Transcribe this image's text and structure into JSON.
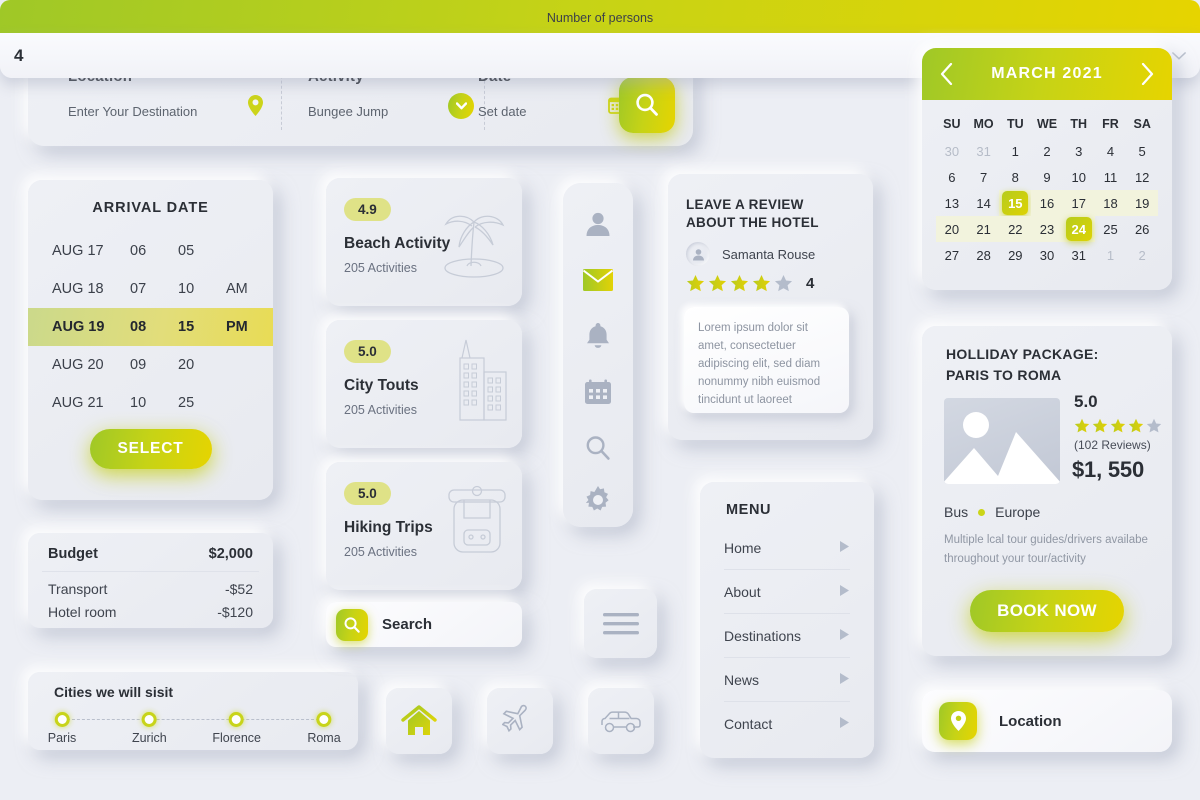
{
  "search_panel": {
    "fields": [
      {
        "label": "Location",
        "value": "Enter Your Destination",
        "icon": "map-pin-icon"
      },
      {
        "label": "Activity",
        "value": "Bungee Jump",
        "icon": "chevron-down-circle-icon"
      },
      {
        "label": "Date",
        "value": "Set date",
        "icon": "calendar-icon"
      }
    ],
    "submit_icon": "search-icon"
  },
  "persons": {
    "header": "Number of persons",
    "value": "4",
    "caret_icon": "chevron-down-icon"
  },
  "calendar": {
    "prev_icon": "chevron-left-icon",
    "next_icon": "chevron-right-icon",
    "month": "MARCH",
    "year": "2021",
    "title": "MARCH  2021",
    "dow": [
      "SU",
      "MO",
      "TU",
      "WE",
      "TH",
      "FR",
      "SA"
    ],
    "weeks": [
      [
        {
          "d": "30",
          "state": "muted"
        },
        {
          "d": "31",
          "state": "muted"
        },
        {
          "d": "1",
          "state": "normal"
        },
        {
          "d": "2",
          "state": "normal"
        },
        {
          "d": "3",
          "state": "normal"
        },
        {
          "d": "4",
          "state": "normal"
        },
        {
          "d": "5",
          "state": "normal"
        }
      ],
      [
        {
          "d": "6",
          "state": "normal"
        },
        {
          "d": "7",
          "state": "normal"
        },
        {
          "d": "8",
          "state": "normal"
        },
        {
          "d": "9",
          "state": "normal"
        },
        {
          "d": "10",
          "state": "normal"
        },
        {
          "d": "11",
          "state": "normal"
        },
        {
          "d": "12",
          "state": "normal"
        }
      ],
      [
        {
          "d": "13",
          "state": "normal"
        },
        {
          "d": "14",
          "state": "normal"
        },
        {
          "d": "15",
          "state": "selected"
        },
        {
          "d": "16",
          "state": "inrange"
        },
        {
          "d": "17",
          "state": "inrange"
        },
        {
          "d": "18",
          "state": "inrange"
        },
        {
          "d": "19",
          "state": "inrange"
        }
      ],
      [
        {
          "d": "20",
          "state": "inrange"
        },
        {
          "d": "21",
          "state": "inrange"
        },
        {
          "d": "22",
          "state": "inrange"
        },
        {
          "d": "23",
          "state": "inrange"
        },
        {
          "d": "24",
          "state": "selected"
        },
        {
          "d": "25",
          "state": "normal"
        },
        {
          "d": "26",
          "state": "normal"
        }
      ],
      [
        {
          "d": "27",
          "state": "normal"
        },
        {
          "d": "28",
          "state": "normal"
        },
        {
          "d": "29",
          "state": "normal"
        },
        {
          "d": "30",
          "state": "normal"
        },
        {
          "d": "31",
          "state": "normal"
        },
        {
          "d": "1",
          "state": "muted"
        },
        {
          "d": "2",
          "state": "muted"
        }
      ]
    ]
  },
  "arrival": {
    "title": "ARRIVAL DATE",
    "rows": [
      {
        "date": "AUG 17",
        "hour": "06",
        "minute": "05",
        "meridiem": "",
        "active": false
      },
      {
        "date": "AUG 18",
        "hour": "07",
        "minute": "10",
        "meridiem": "AM",
        "active": false
      },
      {
        "date": "AUG 19",
        "hour": "08",
        "minute": "15",
        "meridiem": "PM",
        "active": true
      },
      {
        "date": "AUG 20",
        "hour": "09",
        "minute": "20",
        "meridiem": "",
        "active": false
      },
      {
        "date": "AUG 21",
        "hour": "10",
        "minute": "25",
        "meridiem": "",
        "active": false
      }
    ],
    "select_label": "SELECT"
  },
  "budget": {
    "title": "Budget",
    "total": "$2,000",
    "lines": [
      {
        "label": "Transport",
        "amount": "-$52"
      },
      {
        "label": "Hotel room",
        "amount": "-$120"
      }
    ]
  },
  "cities": {
    "title": "Cities we will sisit",
    "items": [
      {
        "label": "Paris"
      },
      {
        "label": "Zurich"
      },
      {
        "label": "Florence"
      },
      {
        "label": "Roma"
      }
    ]
  },
  "activities": [
    {
      "rating": "4.9",
      "name": "Beach Activity",
      "count": "205 Activities",
      "icon": "palm-tree-icon"
    },
    {
      "rating": "5.0",
      "name": "City Touts",
      "count": "205 Activities",
      "icon": "buildings-icon"
    },
    {
      "rating": "5.0",
      "name": "Hiking Trips",
      "count": "205 Activities",
      "icon": "backpack-icon"
    }
  ],
  "icon_rail": [
    {
      "name": "user-icon",
      "active": false
    },
    {
      "name": "mail-icon",
      "active": true
    },
    {
      "name": "bell-icon",
      "active": false
    },
    {
      "name": "calendar-icon",
      "active": false
    },
    {
      "name": "search-icon",
      "active": false
    },
    {
      "name": "gear-icon",
      "active": false
    }
  ],
  "review": {
    "title": "LEAVE A REVIEW ABOUT THE HOTEL",
    "reviewer": "Samanta Rouse",
    "avatar_icon": "user-avatar-icon",
    "stars_filled": 4,
    "stars_total": 5,
    "score": "4",
    "text": "Lorem ipsum dolor sit amet, consectetuer adipiscing elit, sed diam nonummy nibh euismod tincidunt ut laoreet"
  },
  "package": {
    "title": "HOLLIDAY PACKAGE: PARIS TO ROMA",
    "title_line1": "HOLLIDAY PACKAGE:",
    "title_line2": "PARIS TO ROMA",
    "rating": "5.0",
    "stars_filled": 4,
    "stars_total": 5,
    "reviews": "(102 Reviews)",
    "price": "$1, 550",
    "tag_left": "Bus",
    "tag_right": "Europe",
    "description": "Multiple lcal tour guides/drivers availabe throughout your tour/activity",
    "book_label": "BOOK NOW"
  },
  "menu": {
    "title": "MENU",
    "items": [
      {
        "label": "Home",
        "caret_icon": "caret-right-icon"
      },
      {
        "label": "About",
        "caret_icon": "caret-right-icon"
      },
      {
        "label": "Destinations",
        "caret_icon": "caret-right-icon"
      },
      {
        "label": "News",
        "caret_icon": "caret-right-icon"
      },
      {
        "label": "Contact",
        "caret_icon": "caret-right-icon"
      }
    ]
  },
  "search_bar": {
    "label": "Search",
    "icon": "search-icon"
  },
  "hamburger": {
    "icon": "hamburger-menu-icon"
  },
  "tiles": [
    {
      "icon": "home-icon",
      "active": true
    },
    {
      "icon": "airplane-icon",
      "active": false
    },
    {
      "icon": "car-icon",
      "active": false
    }
  ],
  "location_widget": {
    "label": "Location",
    "icon": "map-pin-icon"
  },
  "colors": {
    "background": "#eceef4",
    "card": "#eef0f5",
    "accent_green": "#9fc827",
    "accent_yellow": "#e6d400",
    "badge": "#dfe287",
    "star_filled": "#ccd41a",
    "star_empty": "#b4bccb",
    "text": "#2b2f36",
    "muted_text": "#8d94a1"
  }
}
